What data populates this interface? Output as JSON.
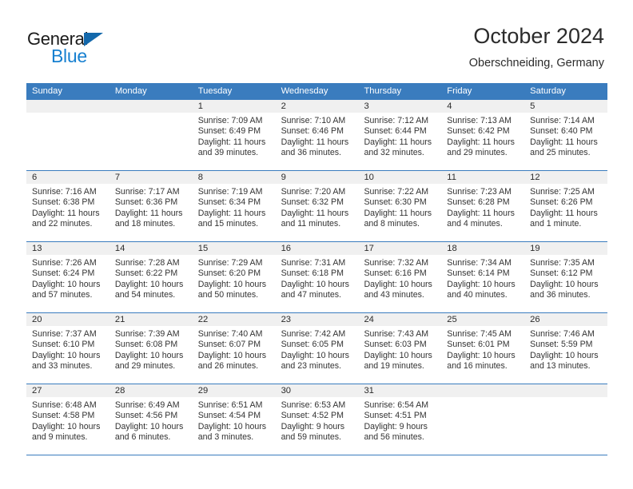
{
  "brand": {
    "name_part1": "General",
    "name_part2": "Blue"
  },
  "header": {
    "title": "October 2024",
    "location": "Oberschneiding, Germany"
  },
  "colors": {
    "header_blue": "#3A7CBE",
    "logo_blue": "#1780d0",
    "day_strip_gray": "#F0F0F0"
  },
  "weekdays": [
    "Sunday",
    "Monday",
    "Tuesday",
    "Wednesday",
    "Thursday",
    "Friday",
    "Saturday"
  ],
  "weeks": [
    [
      {
        "day": "",
        "sunrise": "",
        "sunset": "",
        "daylight1": "",
        "daylight2": ""
      },
      {
        "day": "",
        "sunrise": "",
        "sunset": "",
        "daylight1": "",
        "daylight2": ""
      },
      {
        "day": "1",
        "sunrise": "Sunrise: 7:09 AM",
        "sunset": "Sunset: 6:49 PM",
        "daylight1": "Daylight: 11 hours",
        "daylight2": "and 39 minutes."
      },
      {
        "day": "2",
        "sunrise": "Sunrise: 7:10 AM",
        "sunset": "Sunset: 6:46 PM",
        "daylight1": "Daylight: 11 hours",
        "daylight2": "and 36 minutes."
      },
      {
        "day": "3",
        "sunrise": "Sunrise: 7:12 AM",
        "sunset": "Sunset: 6:44 PM",
        "daylight1": "Daylight: 11 hours",
        "daylight2": "and 32 minutes."
      },
      {
        "day": "4",
        "sunrise": "Sunrise: 7:13 AM",
        "sunset": "Sunset: 6:42 PM",
        "daylight1": "Daylight: 11 hours",
        "daylight2": "and 29 minutes."
      },
      {
        "day": "5",
        "sunrise": "Sunrise: 7:14 AM",
        "sunset": "Sunset: 6:40 PM",
        "daylight1": "Daylight: 11 hours",
        "daylight2": "and 25 minutes."
      }
    ],
    [
      {
        "day": "6",
        "sunrise": "Sunrise: 7:16 AM",
        "sunset": "Sunset: 6:38 PM",
        "daylight1": "Daylight: 11 hours",
        "daylight2": "and 22 minutes."
      },
      {
        "day": "7",
        "sunrise": "Sunrise: 7:17 AM",
        "sunset": "Sunset: 6:36 PM",
        "daylight1": "Daylight: 11 hours",
        "daylight2": "and 18 minutes."
      },
      {
        "day": "8",
        "sunrise": "Sunrise: 7:19 AM",
        "sunset": "Sunset: 6:34 PM",
        "daylight1": "Daylight: 11 hours",
        "daylight2": "and 15 minutes."
      },
      {
        "day": "9",
        "sunrise": "Sunrise: 7:20 AM",
        "sunset": "Sunset: 6:32 PM",
        "daylight1": "Daylight: 11 hours",
        "daylight2": "and 11 minutes."
      },
      {
        "day": "10",
        "sunrise": "Sunrise: 7:22 AM",
        "sunset": "Sunset: 6:30 PM",
        "daylight1": "Daylight: 11 hours",
        "daylight2": "and 8 minutes."
      },
      {
        "day": "11",
        "sunrise": "Sunrise: 7:23 AM",
        "sunset": "Sunset: 6:28 PM",
        "daylight1": "Daylight: 11 hours",
        "daylight2": "and 4 minutes."
      },
      {
        "day": "12",
        "sunrise": "Sunrise: 7:25 AM",
        "sunset": "Sunset: 6:26 PM",
        "daylight1": "Daylight: 11 hours",
        "daylight2": "and 1 minute."
      }
    ],
    [
      {
        "day": "13",
        "sunrise": "Sunrise: 7:26 AM",
        "sunset": "Sunset: 6:24 PM",
        "daylight1": "Daylight: 10 hours",
        "daylight2": "and 57 minutes."
      },
      {
        "day": "14",
        "sunrise": "Sunrise: 7:28 AM",
        "sunset": "Sunset: 6:22 PM",
        "daylight1": "Daylight: 10 hours",
        "daylight2": "and 54 minutes."
      },
      {
        "day": "15",
        "sunrise": "Sunrise: 7:29 AM",
        "sunset": "Sunset: 6:20 PM",
        "daylight1": "Daylight: 10 hours",
        "daylight2": "and 50 minutes."
      },
      {
        "day": "16",
        "sunrise": "Sunrise: 7:31 AM",
        "sunset": "Sunset: 6:18 PM",
        "daylight1": "Daylight: 10 hours",
        "daylight2": "and 47 minutes."
      },
      {
        "day": "17",
        "sunrise": "Sunrise: 7:32 AM",
        "sunset": "Sunset: 6:16 PM",
        "daylight1": "Daylight: 10 hours",
        "daylight2": "and 43 minutes."
      },
      {
        "day": "18",
        "sunrise": "Sunrise: 7:34 AM",
        "sunset": "Sunset: 6:14 PM",
        "daylight1": "Daylight: 10 hours",
        "daylight2": "and 40 minutes."
      },
      {
        "day": "19",
        "sunrise": "Sunrise: 7:35 AM",
        "sunset": "Sunset: 6:12 PM",
        "daylight1": "Daylight: 10 hours",
        "daylight2": "and 36 minutes."
      }
    ],
    [
      {
        "day": "20",
        "sunrise": "Sunrise: 7:37 AM",
        "sunset": "Sunset: 6:10 PM",
        "daylight1": "Daylight: 10 hours",
        "daylight2": "and 33 minutes."
      },
      {
        "day": "21",
        "sunrise": "Sunrise: 7:39 AM",
        "sunset": "Sunset: 6:08 PM",
        "daylight1": "Daylight: 10 hours",
        "daylight2": "and 29 minutes."
      },
      {
        "day": "22",
        "sunrise": "Sunrise: 7:40 AM",
        "sunset": "Sunset: 6:07 PM",
        "daylight1": "Daylight: 10 hours",
        "daylight2": "and 26 minutes."
      },
      {
        "day": "23",
        "sunrise": "Sunrise: 7:42 AM",
        "sunset": "Sunset: 6:05 PM",
        "daylight1": "Daylight: 10 hours",
        "daylight2": "and 23 minutes."
      },
      {
        "day": "24",
        "sunrise": "Sunrise: 7:43 AM",
        "sunset": "Sunset: 6:03 PM",
        "daylight1": "Daylight: 10 hours",
        "daylight2": "and 19 minutes."
      },
      {
        "day": "25",
        "sunrise": "Sunrise: 7:45 AM",
        "sunset": "Sunset: 6:01 PM",
        "daylight1": "Daylight: 10 hours",
        "daylight2": "and 16 minutes."
      },
      {
        "day": "26",
        "sunrise": "Sunrise: 7:46 AM",
        "sunset": "Sunset: 5:59 PM",
        "daylight1": "Daylight: 10 hours",
        "daylight2": "and 13 minutes."
      }
    ],
    [
      {
        "day": "27",
        "sunrise": "Sunrise: 6:48 AM",
        "sunset": "Sunset: 4:58 PM",
        "daylight1": "Daylight: 10 hours",
        "daylight2": "and 9 minutes."
      },
      {
        "day": "28",
        "sunrise": "Sunrise: 6:49 AM",
        "sunset": "Sunset: 4:56 PM",
        "daylight1": "Daylight: 10 hours",
        "daylight2": "and 6 minutes."
      },
      {
        "day": "29",
        "sunrise": "Sunrise: 6:51 AM",
        "sunset": "Sunset: 4:54 PM",
        "daylight1": "Daylight: 10 hours",
        "daylight2": "and 3 minutes."
      },
      {
        "day": "30",
        "sunrise": "Sunrise: 6:53 AM",
        "sunset": "Sunset: 4:52 PM",
        "daylight1": "Daylight: 9 hours",
        "daylight2": "and 59 minutes."
      },
      {
        "day": "31",
        "sunrise": "Sunrise: 6:54 AM",
        "sunset": "Sunset: 4:51 PM",
        "daylight1": "Daylight: 9 hours",
        "daylight2": "and 56 minutes."
      },
      {
        "day": "",
        "sunrise": "",
        "sunset": "",
        "daylight1": "",
        "daylight2": ""
      },
      {
        "day": "",
        "sunrise": "",
        "sunset": "",
        "daylight1": "",
        "daylight2": ""
      }
    ]
  ]
}
